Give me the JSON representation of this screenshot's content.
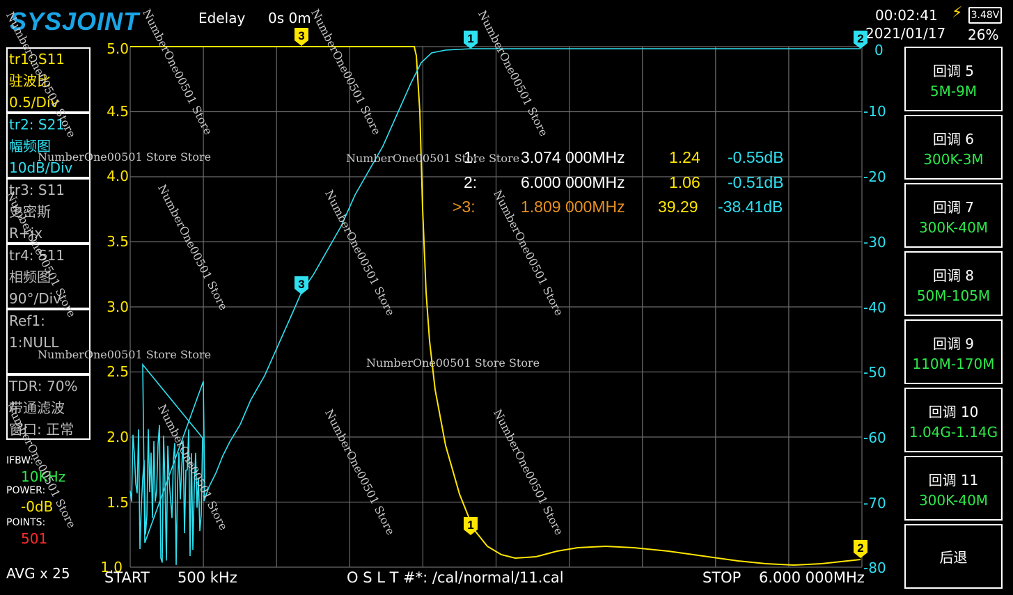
{
  "header": {
    "logo": "SYSJOINT",
    "edelay_label": "Edelay",
    "edelay_value": "0s 0m",
    "time": "00:02:41",
    "date": "2021/01/17",
    "battery_voltage": "3.48V",
    "battery_percent": "26%"
  },
  "traces": [
    {
      "line1": "tr1:  S11",
      "line2": "驻波比",
      "line3": "0.5/Div"
    },
    {
      "line1": "tr2:  S21",
      "line2": "幅频图",
      "line3": "10dB/Div"
    },
    {
      "line1": "tr3:  S11",
      "line2": "史密斯",
      "line3": "R+jx"
    },
    {
      "line1": "tr4:  S11",
      "line2": "相频图",
      "line3": "90°/Div"
    },
    {
      "line1": "Ref1:",
      "line2": "1:NULL",
      "line3": ""
    },
    {
      "line1": "TDR: 70%",
      "line2": "带通滤波",
      "line3": "窗口: 正常"
    }
  ],
  "settings": {
    "ifbw_label": "IFBW:",
    "ifbw_value": "10KHz",
    "power_label": "POWER:",
    "power_value": "-0dB",
    "points_label": "POINTS:",
    "points_value": "501",
    "avg": "AVG x 25"
  },
  "left_axis": [
    "5.0",
    "4.5",
    "4.0",
    "3.5",
    "3.0",
    "2.5",
    "2.0",
    "1.5",
    "1.0"
  ],
  "right_axis": [
    "0",
    "-10",
    "-20",
    "-30",
    "-40",
    "-50",
    "-60",
    "-70",
    "-80"
  ],
  "markers": [
    {
      "id": "1:",
      "freq": "3.074 000MHz",
      "swr": "1.24",
      "db": "-0.55dB"
    },
    {
      "id": "2:",
      "freq": "6.000 000MHz",
      "swr": "1.06",
      "db": "-0.51dB"
    },
    {
      "id": ">3:",
      "freq": "1.809 000MHz",
      "swr": "39.29",
      "db": "-38.41dB"
    }
  ],
  "plot_markers": {
    "m1": "1",
    "m2": "2",
    "m3": "3"
  },
  "bottom": {
    "start_label": "START",
    "start_value": "500 kHz",
    "cal": "O S L T #*: /cal/normal/11.cal",
    "stop_label": "STOP",
    "stop_value": "6.000 000MHz"
  },
  "presets": [
    {
      "title": "回调 5",
      "range": "5M-9M"
    },
    {
      "title": "回调 6",
      "range": "300K-3M"
    },
    {
      "title": "回调 7",
      "range": "300K-40M"
    },
    {
      "title": "回调 8",
      "range": "50M-105M"
    },
    {
      "title": "回调 9",
      "range": "110M-170M"
    },
    {
      "title": "回调 10",
      "range": "1.04G-1.14G"
    },
    {
      "title": "回调 11",
      "range": "300K-40M"
    }
  ],
  "back_button": "后退",
  "watermark": "NumberOne00501 Store",
  "watermark2": "NumberOne00501 Store Store",
  "colors": {
    "swr": "#ffe600",
    "s21": "#2ee0f0",
    "grid": "#777777",
    "preset_range": "#2ee84a"
  }
}
